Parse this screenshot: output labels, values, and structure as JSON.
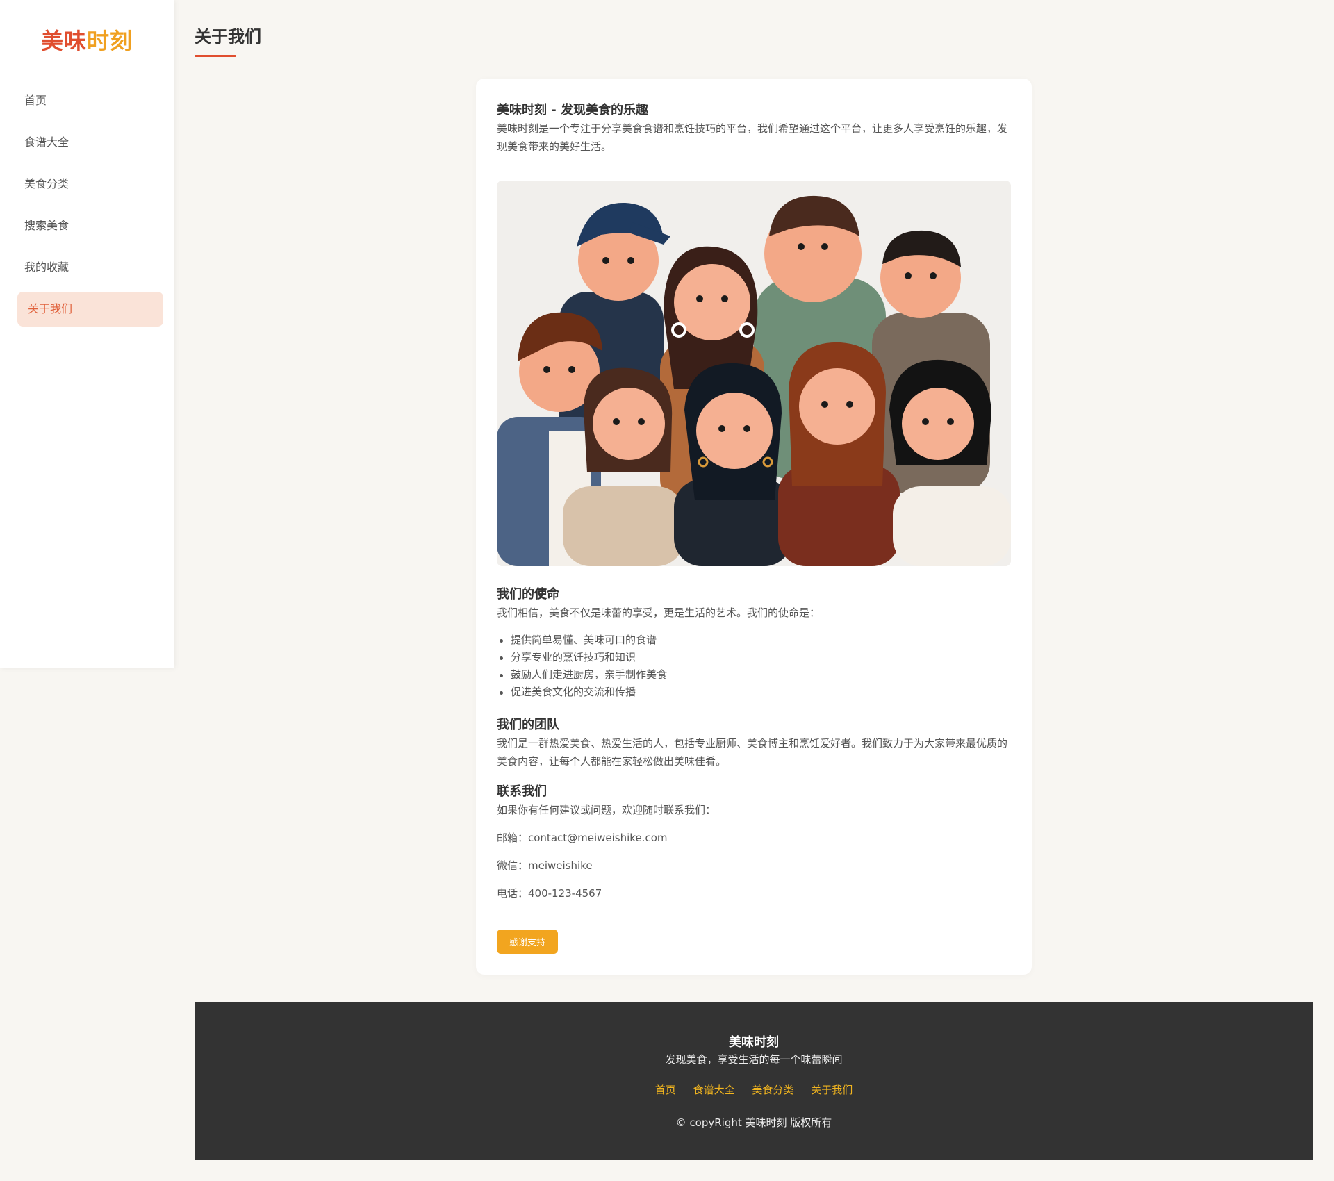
{
  "brand": {
    "part1": "美味",
    "part2": "时刻"
  },
  "nav": {
    "items": [
      {
        "label": "首页"
      },
      {
        "label": "食谱大全"
      },
      {
        "label": "美食分类"
      },
      {
        "label": "搜索美食"
      },
      {
        "label": "我的收藏"
      },
      {
        "label": "关于我们",
        "active": true
      }
    ]
  },
  "page": {
    "title": "关于我们"
  },
  "intro": {
    "title": "美味时刻 - 发现美食的乐趣",
    "text": "美味时刻是一个专注于分享美食食谱和烹饪技巧的平台，我们希望通过这个平台，让更多人享受烹饪的乐趣，发现美食带来的美好生活。"
  },
  "mission": {
    "title": "我们的使命",
    "text": "我们相信，美食不仅是味蕾的享受，更是生活的艺术。我们的使命是：",
    "items": [
      "提供简单易懂、美味可口的食谱",
      "分享专业的烹饪技巧和知识",
      "鼓励人们走进厨房，亲手制作美食",
      "促进美食文化的交流和传播"
    ]
  },
  "team": {
    "title": "我们的团队",
    "text": "我们是一群热爱美食、热爱生活的人，包括专业厨师、美食博主和烹饪爱好者。我们致力于为大家带来最优质的美食内容，让每个人都能在家轻松做出美味佳肴。"
  },
  "contact": {
    "title": "联系我们",
    "text": "如果你有任何建议或问题，欢迎随时联系我们：",
    "email": "邮箱：contact@meiweishike.com",
    "wechat": "微信：meiweishike",
    "phone": "电话：400-123-4567"
  },
  "thanks_button": "感谢支持",
  "footer": {
    "title": "美味时刻",
    "slogan": "发现美食，享受生活的每一个味蕾瞬间",
    "links": [
      "首页",
      "食谱大全",
      "美食分类",
      "关于我们"
    ],
    "copyright": "© copyRight 美味时刻 版权所有"
  },
  "colors": {
    "brand_red": "#e04e2f",
    "brand_orange": "#f0a020",
    "active_nav_bg": "#fae3d8",
    "button_bg": "#f2a51f",
    "footer_bg": "#333333",
    "footer_link": "#f2b51f"
  }
}
